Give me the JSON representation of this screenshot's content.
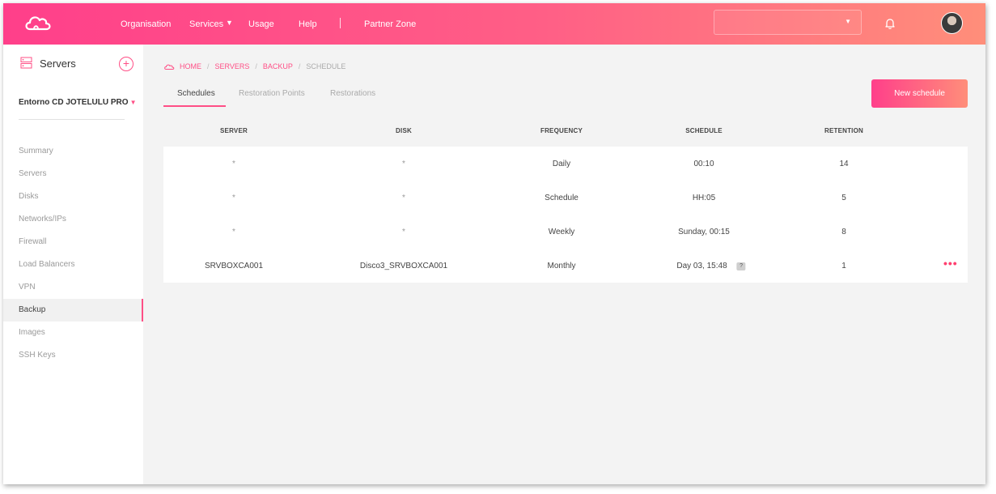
{
  "header": {
    "nav": [
      {
        "label": "Organisation"
      },
      {
        "label": "Services"
      },
      {
        "label": "Usage"
      },
      {
        "label": "Help"
      },
      {
        "label": "Partner Zone"
      }
    ],
    "org_select_value": "",
    "accent_color": "#ff4f86"
  },
  "sidebar": {
    "title": "Servers",
    "add_symbol": "+",
    "environment": "Entorno CD JOTELULU PRO",
    "items": [
      {
        "label": "Summary"
      },
      {
        "label": "Servers"
      },
      {
        "label": "Disks"
      },
      {
        "label": "Networks/IPs"
      },
      {
        "label": "Firewall"
      },
      {
        "label": "Load Balancers"
      },
      {
        "label": "VPN"
      },
      {
        "label": "Backup",
        "active": true
      },
      {
        "label": "Images"
      },
      {
        "label": "SSH Keys"
      }
    ]
  },
  "breadcrumb": {
    "items": [
      "HOME",
      "SERVERS",
      "BACKUP"
    ],
    "current": "SCHEDULE",
    "separator": "/"
  },
  "tabs": [
    {
      "label": "Schedules",
      "active": true
    },
    {
      "label": "Restoration Points"
    },
    {
      "label": "Restorations"
    }
  ],
  "new_schedule_label": "New schedule",
  "table": {
    "columns": [
      "SERVER",
      "DISK",
      "FREQUENCY",
      "SCHEDULE",
      "RETENTION"
    ],
    "rows": [
      {
        "server": "*",
        "disk": "*",
        "frequency": "Daily",
        "schedule": "00:10",
        "retention": "14"
      },
      {
        "server": "*",
        "disk": "*",
        "frequency": "Schedule",
        "schedule": "HH:05",
        "retention": "5"
      },
      {
        "server": "*",
        "disk": "*",
        "frequency": "Weekly",
        "schedule": "Sunday, 00:15",
        "retention": "8"
      },
      {
        "server": "SRVBOXCA001",
        "disk": "Disco3_SRVBOXCA001",
        "frequency": "Monthly",
        "schedule": "Day 03, 15:48",
        "schedule_help": "?",
        "retention": "1",
        "menu": "•••"
      }
    ]
  }
}
